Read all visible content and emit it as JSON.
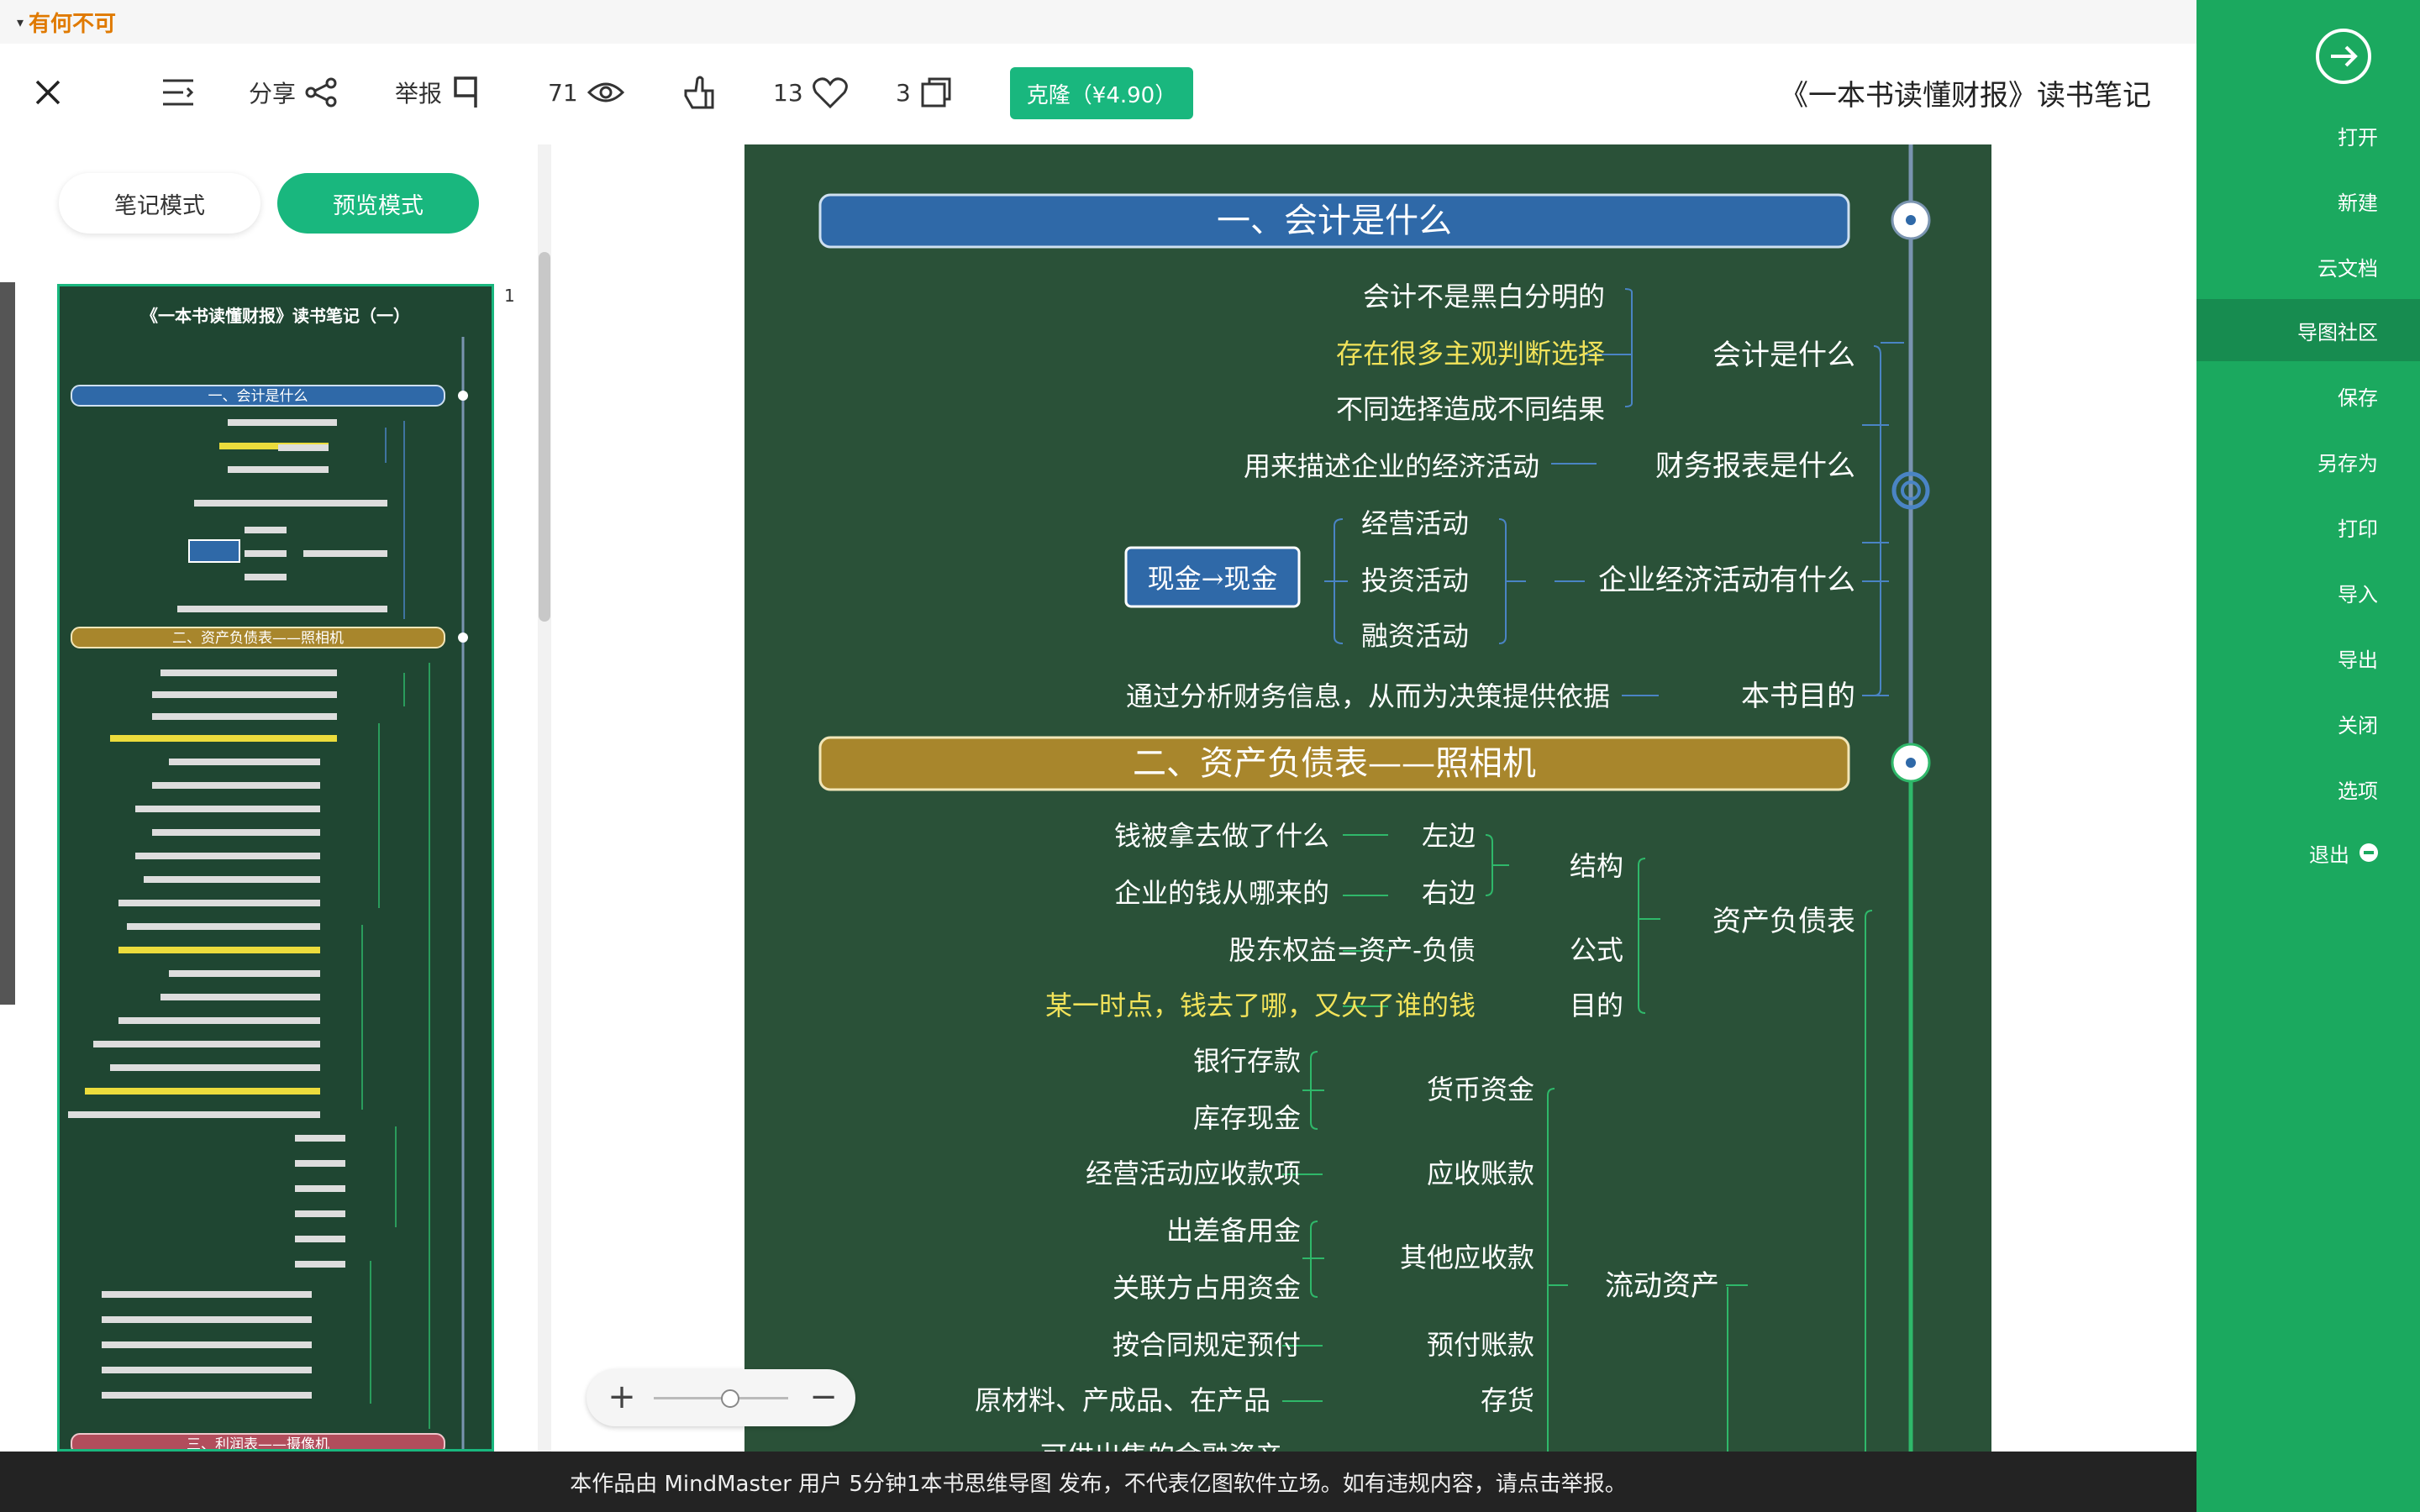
{
  "app": {
    "brand": "有何不可"
  },
  "toolbar": {
    "clone_label": "克隆（¥4.90）",
    "copies_count": "3",
    "likes_count": "13",
    "views_count": "71",
    "report_label": "举报",
    "share_label": "分享"
  },
  "document": {
    "title": "《一本书读懂财报》读书笔记"
  },
  "modes": {
    "preview": "预览模式",
    "note": "笔记模式"
  },
  "thumb": {
    "page_index": "1",
    "title": "《一本书读懂财报》读书笔记（一）",
    "section1": "一、会计是什么",
    "section2": "二、资产负债表——照相机",
    "section3": "三、利润表——摄像机"
  },
  "mindmap": {
    "section1": {
      "title": "一、会计是什么",
      "topic1": "会计是什么",
      "t1_items": [
        "会计不是黑白分明的",
        "存在很多主观判断选择",
        "不同选择造成不同结果"
      ],
      "topic2": "财务报表是什么",
      "t2_item": "用来描述企业的经济活动",
      "topic3": "企业经济活动有什么",
      "t3_items": [
        "经营活动",
        "投资活动",
        "融资活动"
      ],
      "cash_box": "现金→现金",
      "topic4": "本书目的",
      "t4_item": "通过分析财务信息，从而为决策提供依据"
    },
    "section2": {
      "title": "二、资产负债表——照相机",
      "balance_sheet": "资产负债表",
      "structure": "结构",
      "left": "左边",
      "left_desc": "钱被拿去做了什么",
      "right": "右边",
      "right_desc": "企业的钱从哪来的",
      "formula": "公式",
      "formula_desc": "股东权益=资产-负债",
      "purpose": "目的",
      "purpose_desc": "某一时点，钱去了哪，又欠了谁的钱",
      "current_assets": "流动资产",
      "monetary": "货币资金",
      "bank_deposit": "银行存款",
      "cash_on_hand": "库存现金",
      "receivables": "应收账款",
      "receivables_desc": "经营活动应收款项",
      "other_receivables": "其他应收款",
      "petty_cash": "出差备用金",
      "related_funds": "关联方占用资金",
      "prepayments": "预付账款",
      "prepayments_desc": "按合同规定预付",
      "inventory": "存货",
      "inventory_desc": "原材料、产成品、在产品",
      "cut_off": "可供出售的金融资产"
    }
  },
  "zoom": {
    "plus": "+",
    "minus": "−",
    "level": 0.55
  },
  "notice": "本作品由 MindMaster 用户 5分钟1本书思维导图 发布，不代表亿图软件立场。如有违规内容，请点击举报。",
  "sidebar": {
    "items": [
      {
        "label": "打开"
      },
      {
        "label": "新建"
      },
      {
        "label": "云文档"
      },
      {
        "label": "导图社区"
      },
      {
        "label": "保存"
      },
      {
        "label": "另存为"
      },
      {
        "label": "打印"
      },
      {
        "label": "导入"
      },
      {
        "label": "导出"
      },
      {
        "label": "关闭"
      },
      {
        "label": "选项"
      }
    ],
    "exit": "退出"
  },
  "colors": {
    "green": "#19b77e",
    "sidebar_green": "#1ba95f",
    "board": "#2a5138",
    "section1_blue": "#2f69a8",
    "section2_gold": "#a8862c",
    "highlight_yellow": "#f2e35a"
  }
}
